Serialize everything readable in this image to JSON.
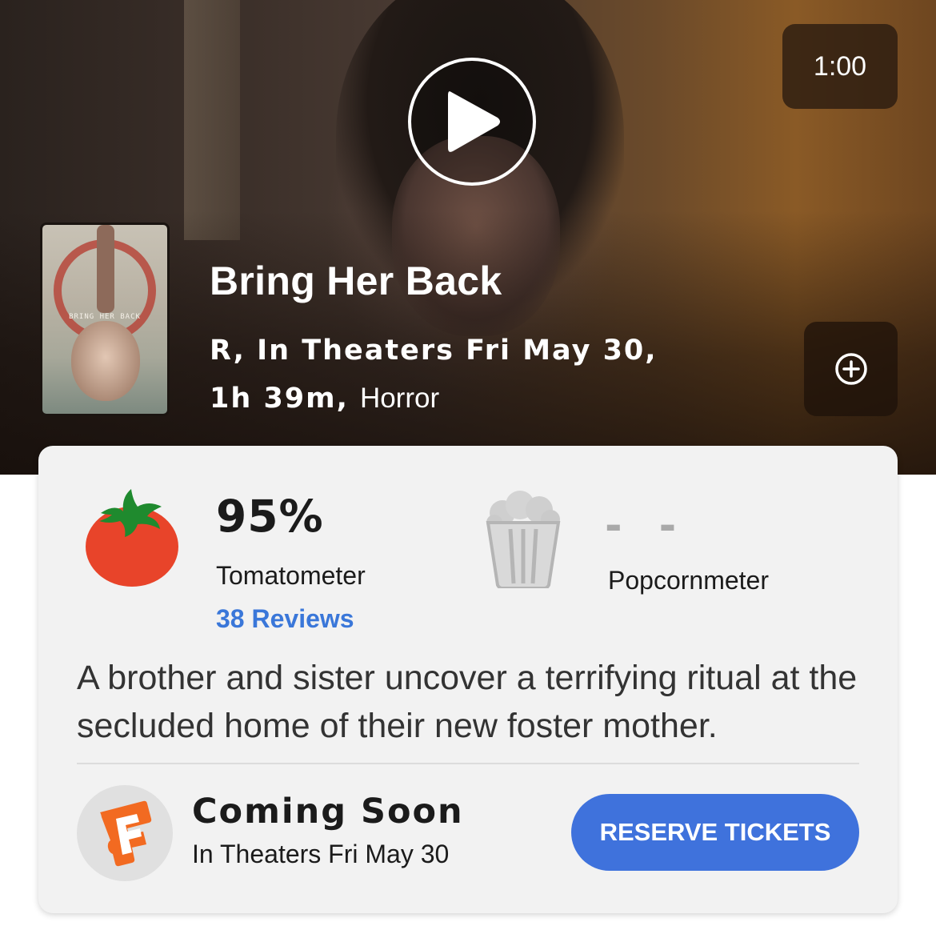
{
  "player": {
    "duration": "1:00",
    "icons": {
      "play": "play-icon",
      "add": "plus-circle-icon"
    }
  },
  "movie": {
    "title": "Bring Her Back",
    "rating_release": "R, In Theaters Fri May 30,",
    "runtime": "1h 39m,",
    "genre": "Horror",
    "poster_text": "BRING HER BACK"
  },
  "scores": {
    "tomatometer": {
      "value": "95%",
      "label": "Tomatometer",
      "reviews": "38 Reviews",
      "icon": "tomato-icon",
      "color": "#e8442a"
    },
    "popcornmeter": {
      "value": "- -",
      "label": "Popcornmeter",
      "icon": "popcorn-icon",
      "color": "#a9a9a9"
    }
  },
  "synopsis": "A brother and sister uncover a terrifying ritual at the secluded home of their new foster mother.",
  "tickets": {
    "status": "Coming Soon",
    "date": "In Theaters Fri May 30",
    "button": "RESERVE TICKETS",
    "logo_icon": "fandango-logo-icon",
    "accent": "#3f72dc"
  }
}
